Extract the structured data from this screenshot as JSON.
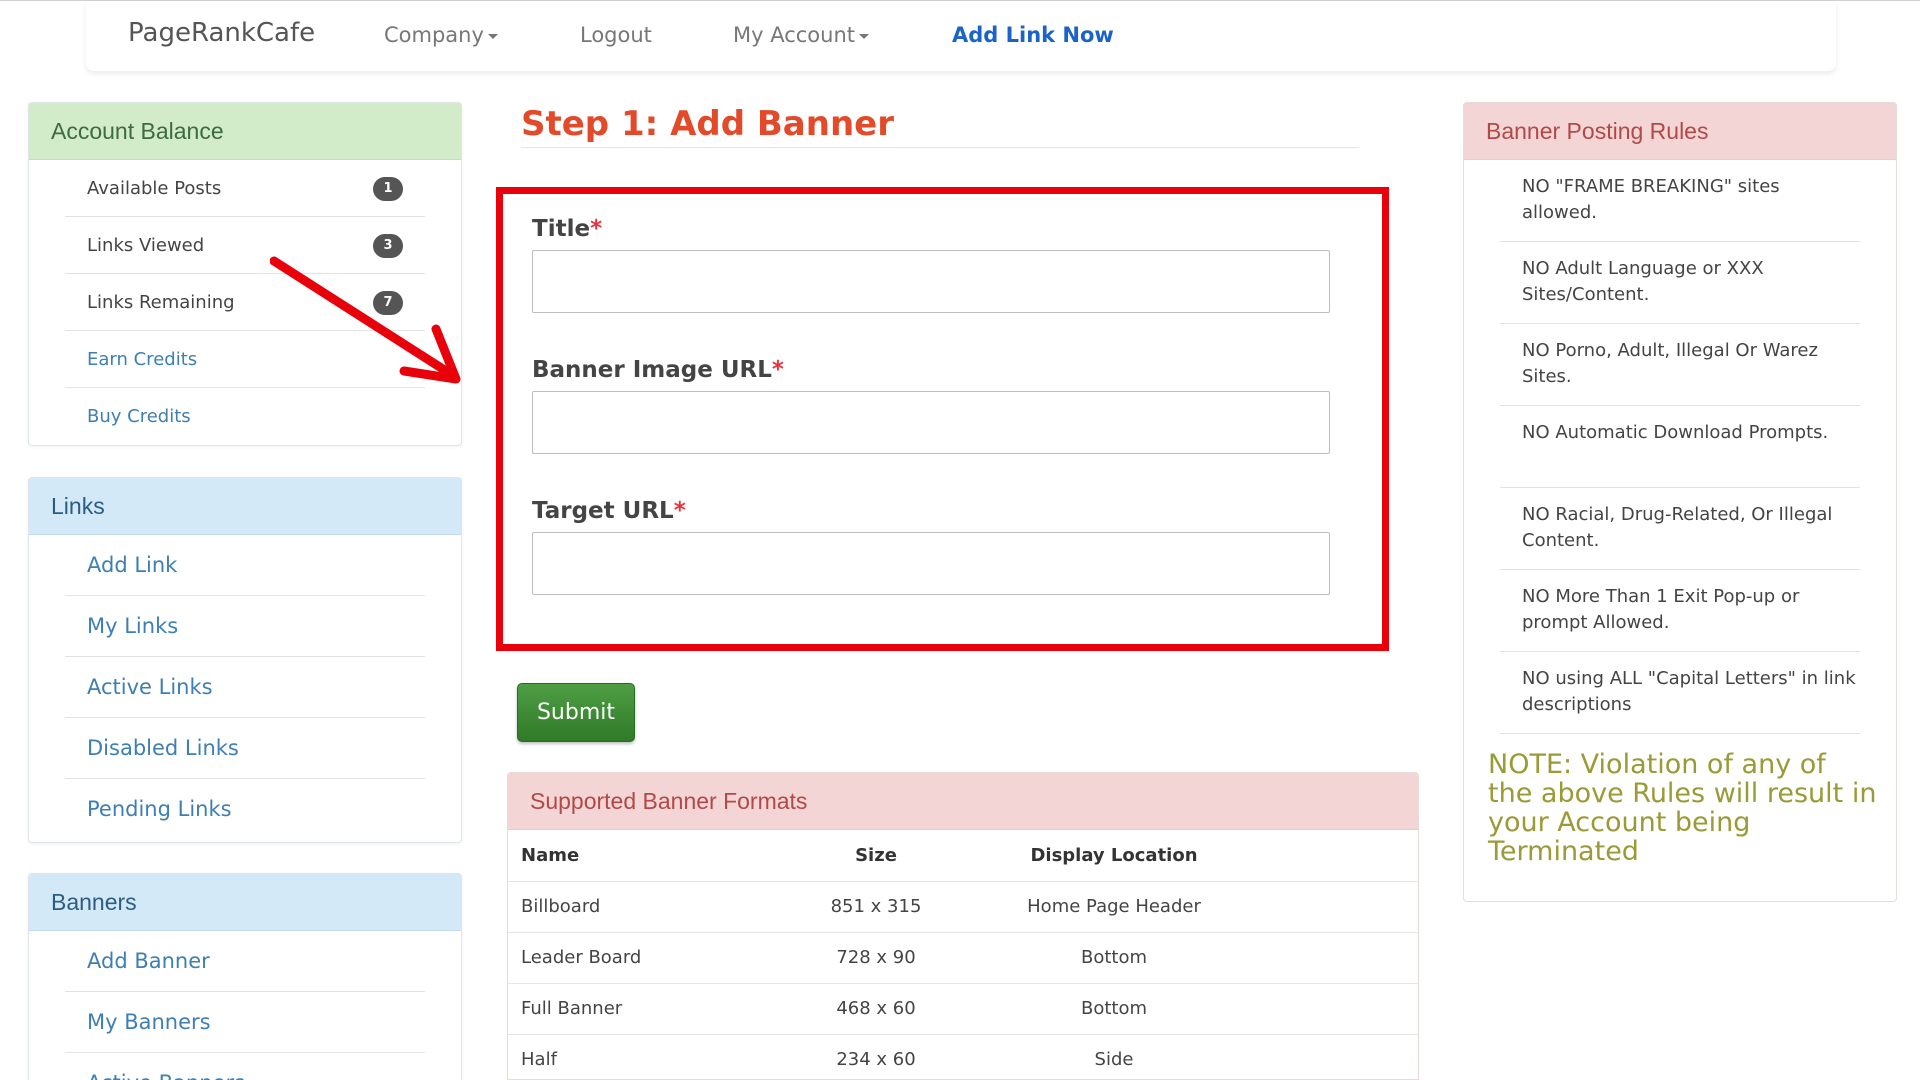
{
  "nav": {
    "brand": "PageRankCafe",
    "company": "Company",
    "logout": "Logout",
    "my_account": "My Account",
    "add_link_now": "Add Link Now"
  },
  "account_balance": {
    "title": "Account Balance",
    "items": [
      {
        "label": "Available Posts",
        "badge": "1"
      },
      {
        "label": "Links Viewed",
        "badge": "3"
      },
      {
        "label": "Links Remaining",
        "badge": "7"
      },
      {
        "label": "Earn Credits"
      },
      {
        "label": "Buy Credits"
      }
    ]
  },
  "links_panel": {
    "title": "Links",
    "items": [
      "Add Link",
      "My Links",
      "Active Links",
      "Disabled Links",
      "Pending Links"
    ]
  },
  "banners_panel": {
    "title": "Banners",
    "items": [
      "Add Banner",
      "My Banners",
      "Active Banners"
    ]
  },
  "form": {
    "heading": "Step 1: Add Banner",
    "title_label": "Title",
    "banner_url_label": "Banner Image URL",
    "target_url_label": "Target URL",
    "required_mark": "*",
    "title_value": "",
    "banner_url_value": "",
    "target_url_value": "",
    "submit_label": "Submit"
  },
  "formats": {
    "title": "Supported Banner Formats",
    "columns": [
      "Name",
      "Size",
      "Display Location"
    ],
    "rows": [
      [
        "Billboard",
        "851 x 315",
        "Home Page Header"
      ],
      [
        "Leader Board",
        "728 x 90",
        "Bottom"
      ],
      [
        "Full Banner",
        "468 x 60",
        "Bottom"
      ],
      [
        "Half",
        "234 x 60",
        "Side"
      ]
    ]
  },
  "rules": {
    "title": "Banner Posting Rules",
    "items": [
      "NO \"FRAME BREAKING\" sites allowed.",
      "NO Adult Language or XXX Sites/Content.",
      "NO Porno, Adult, Illegal Or Warez Sites.",
      "NO Automatic Download Prompts.",
      "NO Racial, Drug-Related, Or Illegal Content.",
      "NO More Than 1 Exit Pop-up or prompt Allowed.",
      "NO using ALL \"Capital Letters\" in link descriptions"
    ],
    "note": "NOTE: Violation of any of the above Rules will result in your Account being Terminated"
  },
  "colors": {
    "accent_title": "#e24a2a",
    "highlight_box": "#e8000b",
    "submit_green": "#3b8a33",
    "link_blue": "#3d7fb4"
  }
}
